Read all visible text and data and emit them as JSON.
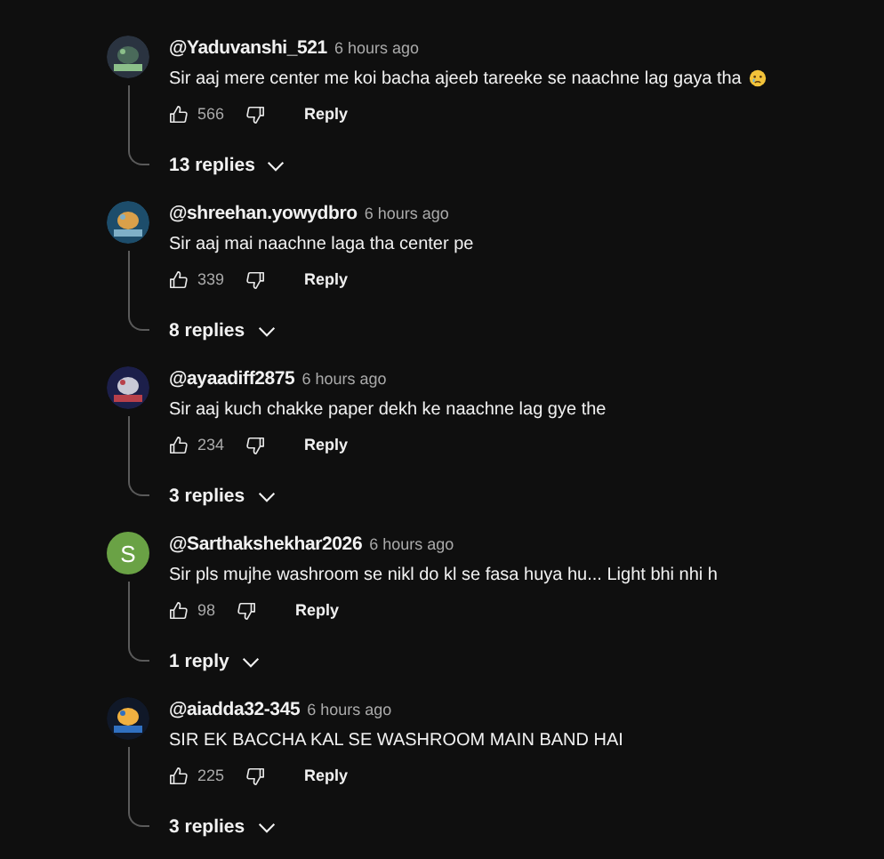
{
  "comments": [
    {
      "author": "@Yaduvanshi_521",
      "time": "6 hours ago",
      "text": "Sir aaj mere center me koi bacha ajeeb tareeke se naachne lag gaya tha",
      "emoji": true,
      "likes": "566",
      "reply_label": "Reply",
      "replies": "13 replies"
    },
    {
      "author": "@shreehan.yowydbro",
      "time": "6 hours ago",
      "text": "Sir aaj mai naachne laga tha center pe",
      "emoji": false,
      "likes": "339",
      "reply_label": "Reply",
      "replies": "8 replies"
    },
    {
      "author": "@ayaadiff2875",
      "time": "6 hours ago",
      "text": "Sir aaj kuch chakke paper dekh ke naachne lag gye the",
      "emoji": false,
      "likes": "234",
      "reply_label": "Reply",
      "replies": "3 replies"
    },
    {
      "avatar": {
        "kind": "letter",
        "letter": "S",
        "color": "#6aa245"
      },
      "author": "@Sarthakshekhar2026",
      "time": "6 hours ago",
      "text": "Sir pls mujhe washroom se nikl do kl se fasa huya hu... Light bhi nhi h",
      "emoji": false,
      "likes": "98",
      "reply_label": "Reply",
      "replies": "1 reply"
    },
    {
      "author": "@aiadda32-345",
      "time": "6 hours ago",
      "text": "SIR EK BACCHA KAL SE WASHROOM MAIN BAND HAI",
      "emoji": false,
      "likes": "225",
      "reply_label": "Reply",
      "replies": "3 replies"
    }
  ]
}
